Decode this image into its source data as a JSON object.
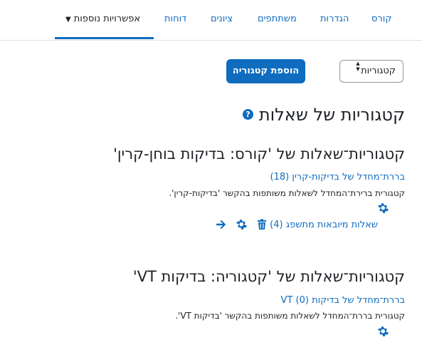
{
  "nav": {
    "tabs": [
      {
        "label": "קורס"
      },
      {
        "label": "הגדרות"
      },
      {
        "label": "משתתפים"
      },
      {
        "label": "ציונים"
      },
      {
        "label": "דוחות"
      },
      {
        "label": "אפשרויות נוספות"
      }
    ]
  },
  "toolbar": {
    "select_label": "קטגוריות",
    "add_button": "הוספת קטגוריה"
  },
  "page": {
    "title": "קטגוריות של שאלות"
  },
  "sections": [
    {
      "heading": "קטגוריות־שאלות של 'קורס: בדיקות בוחן-קרין'",
      "default_link": "בררת־מחדל של בדיקות-קרין (18)",
      "description": "קטגורית ברירת־המחדל לשאלות משותפות בהקשר 'בדיקות-קרין'.",
      "subcategory": "שאלות מיובאות מתשפג (4)"
    },
    {
      "heading": "קטגוריות־שאלות של 'קטגוריה: בדיקות VT'",
      "default_link": "בררת־מחדל של בדיקות VT (0)",
      "description": "קטגורית בררת־המחדל לשאלות משותפות בהקשר 'בדיקות VT'."
    }
  ],
  "colors": {
    "accent": "#0f6cbf",
    "text": "#1d2125",
    "border": "#dee2e6"
  }
}
